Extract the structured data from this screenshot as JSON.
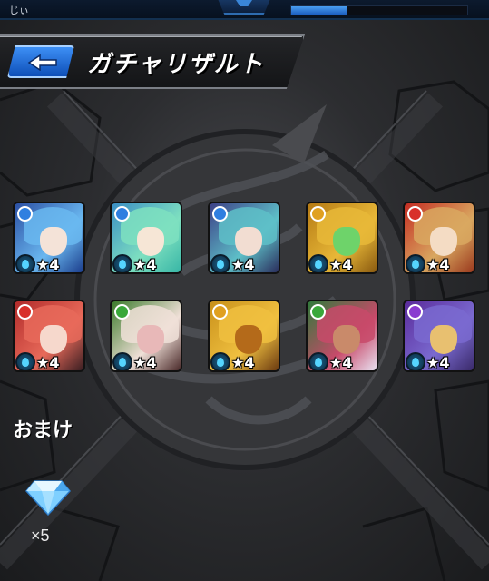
{
  "status_bar": {
    "player_name": "じぃ",
    "stamina_fraction": 0.32
  },
  "header": {
    "back_icon": "back-arrow-icon",
    "title": "ガチャリザルト"
  },
  "results": [
    {
      "element": "water",
      "element_color": "#2f7fe0",
      "theme": [
        "#2b4fa3",
        "#6ab8f0",
        "#f4e3d8",
        "#1b3d8c"
      ],
      "stars": "★4"
    },
    {
      "element": "water",
      "element_color": "#2f7fe0",
      "theme": [
        "#3a8ec4",
        "#7ee0c0",
        "#f6e6d6",
        "#38b6a6"
      ],
      "stars": "★4"
    },
    {
      "element": "water",
      "element_color": "#2f7fe0",
      "theme": [
        "#3c3f86",
        "#5ec0c8",
        "#f2ddd2",
        "#2a2d5c"
      ],
      "stars": "★4"
    },
    {
      "element": "light",
      "element_color": "#e0a020",
      "theme": [
        "#b57a14",
        "#e8b838",
        "#6ed36a",
        "#8a5a10"
      ],
      "stars": "★4"
    },
    {
      "element": "fire",
      "element_color": "#d8302a",
      "theme": [
        "#c42c22",
        "#d9a860",
        "#f4dcc4",
        "#9b3a1e"
      ],
      "stars": "★4"
    },
    {
      "element": "fire",
      "element_color": "#d8302a",
      "theme": [
        "#b12b2a",
        "#e86a5a",
        "#f6d8cc",
        "#3a1e22"
      ],
      "stars": "★4"
    },
    {
      "element": "wood",
      "element_color": "#3aa83a",
      "theme": [
        "#3a7a2a",
        "#f0e0d8",
        "#e8b8b8",
        "#4a2a2a"
      ],
      "stars": "★4"
    },
    {
      "element": "light",
      "element_color": "#e0a020",
      "theme": [
        "#c8901a",
        "#f0c040",
        "#b46a1a",
        "#6b3a10"
      ],
      "stars": "★4"
    },
    {
      "element": "wood",
      "element_color": "#3aa83a",
      "theme": [
        "#2f7a3a",
        "#c84a6a",
        "#c98a6a",
        "#e8e0f0"
      ],
      "stars": "★4"
    },
    {
      "element": "dark",
      "element_color": "#8a3ad0",
      "theme": [
        "#5a2a9a",
        "#7a6ad0",
        "#e8c070",
        "#3a2a6a"
      ],
      "stars": "★4"
    }
  ],
  "bonus": {
    "label": "おまけ",
    "item_icon": "diamond-gem-icon",
    "count": "×5"
  },
  "colors": {
    "accent_blue": "#1e6fe0",
    "background": "#2c2d30"
  }
}
